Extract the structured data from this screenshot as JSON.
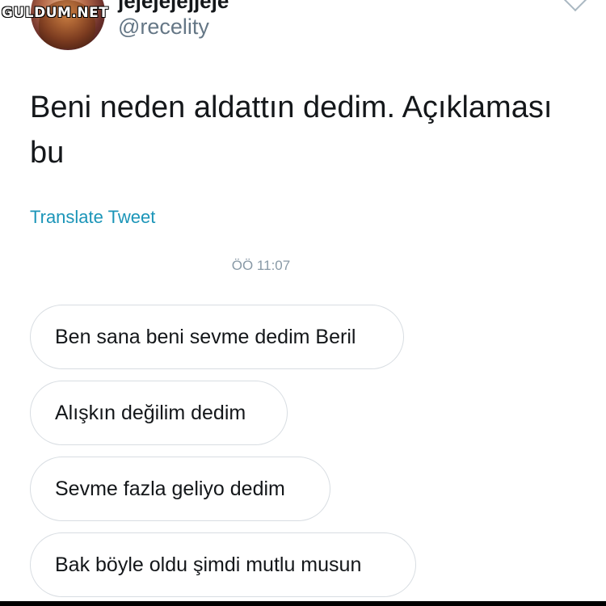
{
  "watermark": "GULDUM.NET",
  "tweet": {
    "display_name": "jejejejejjeje",
    "handle": "@recelity",
    "text": "Beni neden aldattın dedim. Açıklaması bu",
    "translate_label": "Translate Tweet"
  },
  "chat": {
    "timestamp": "ÖÖ 11:07",
    "messages": [
      "Ben sana beni sevme dedim Beril",
      "Alışkın değilim dedim",
      "Sevme fazla geliyo dedim",
      "Bak böyle oldu şimdi mutlu musun"
    ]
  },
  "colors": {
    "link": "#1b95b8",
    "handle": "#657786",
    "timestamp": "#8899a6",
    "bubble_border": "#d8dde2"
  },
  "icons": {
    "menu": "chevron-down-icon"
  }
}
